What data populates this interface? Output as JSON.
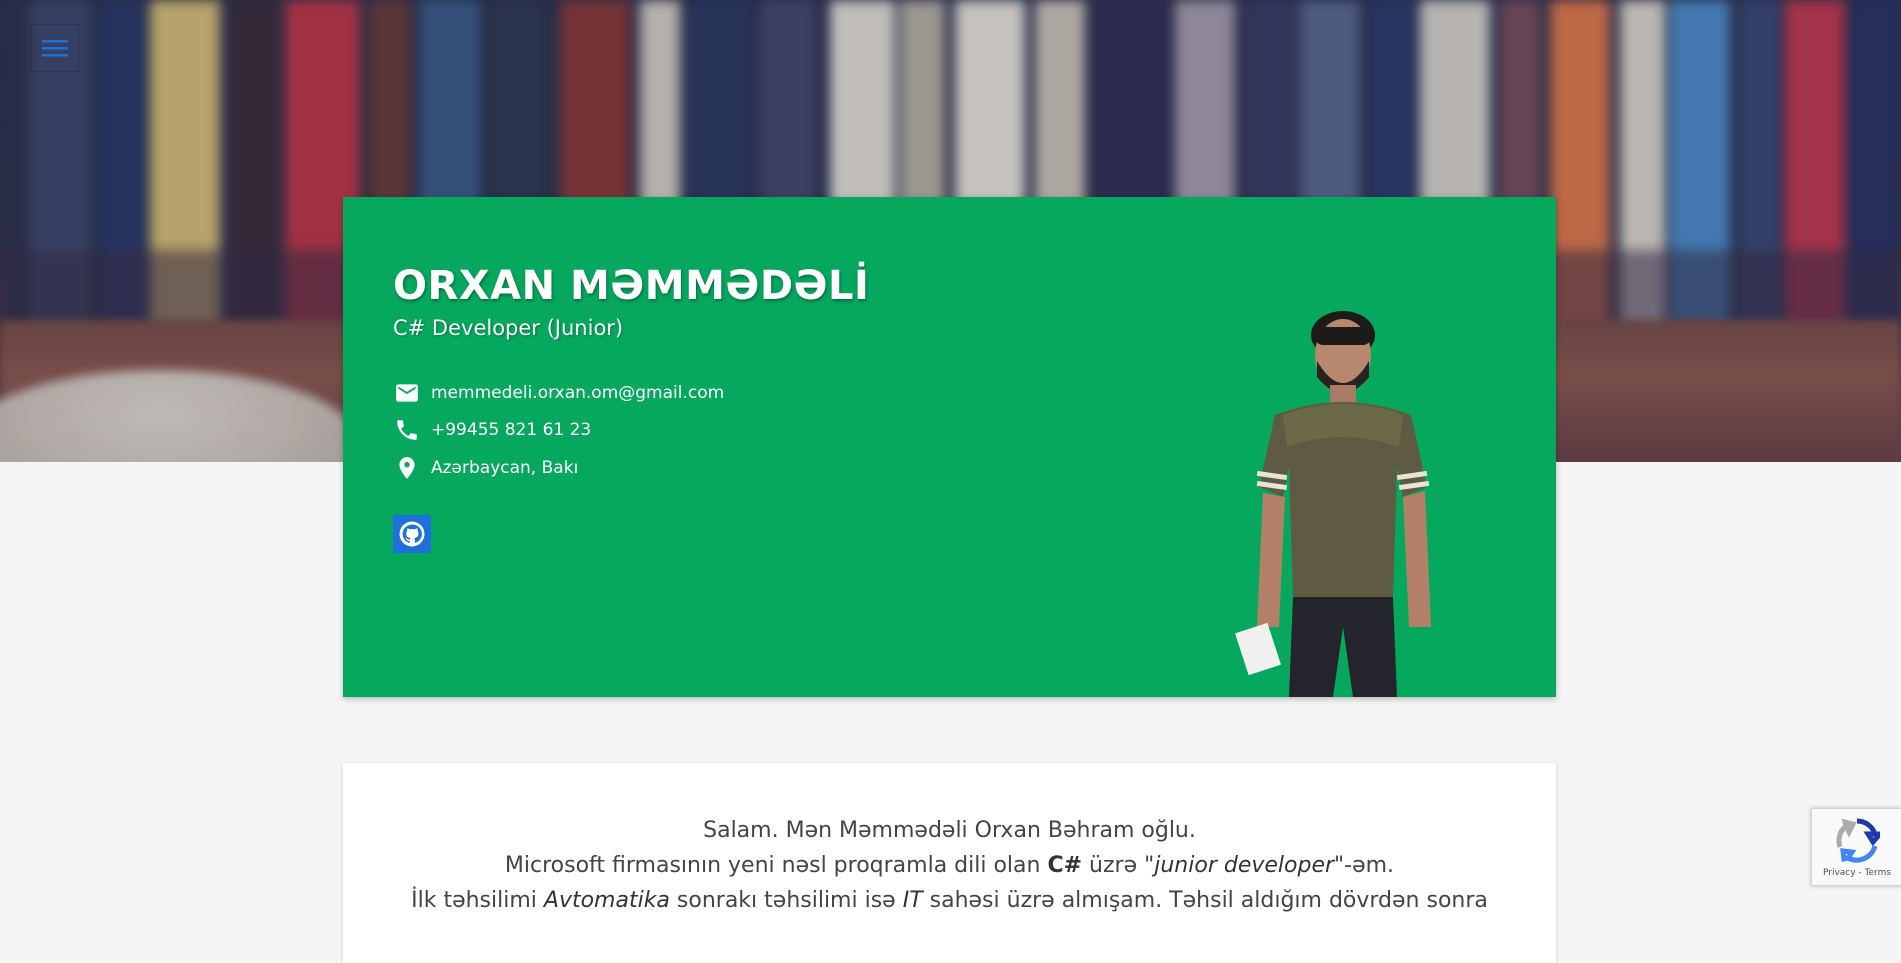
{
  "nav": {
    "menu_icon": "hamburger-menu-icon"
  },
  "profile": {
    "name": "ORXAN MƏMMƏDƏLİ",
    "role": "C# Developer (Junior)",
    "contacts": {
      "email": "memmedeli.orxan.om@gmail.com",
      "phone": "+99455 821 61 23",
      "location": "Azərbaycan, Bakı"
    },
    "icons": {
      "email": "email-icon",
      "phone": "phone-icon",
      "location": "location-pin-icon",
      "github": "github-icon"
    }
  },
  "about": {
    "line1": "Salam. Mən Məmmədəli Orxan Bəhram oğlu.",
    "line2_pre": "Microsoft firmasının yeni nəsl proqramla dili olan ",
    "line2_bold": "C#",
    "line2_mid": " üzrə \"",
    "line2_italic": "junior developer",
    "line2_post": "\"-əm.",
    "line3_pre": "İlk təhsilimi ",
    "line3_italic1": "Avtomatika",
    "line3_mid": " sonrakı təhsilimi isə ",
    "line3_italic2": "IT",
    "line3_post": " sahəsi üzrə almışam. Təhsil aldığım dövrdən sonra"
  },
  "recaptcha": {
    "terms": "Privacy - Terms"
  },
  "colors": {
    "card_green": "#06a85e",
    "github_blue": "#1e6fd9",
    "menu_blue": "#1e6fd9",
    "page_bg": "#f5f5f5"
  }
}
